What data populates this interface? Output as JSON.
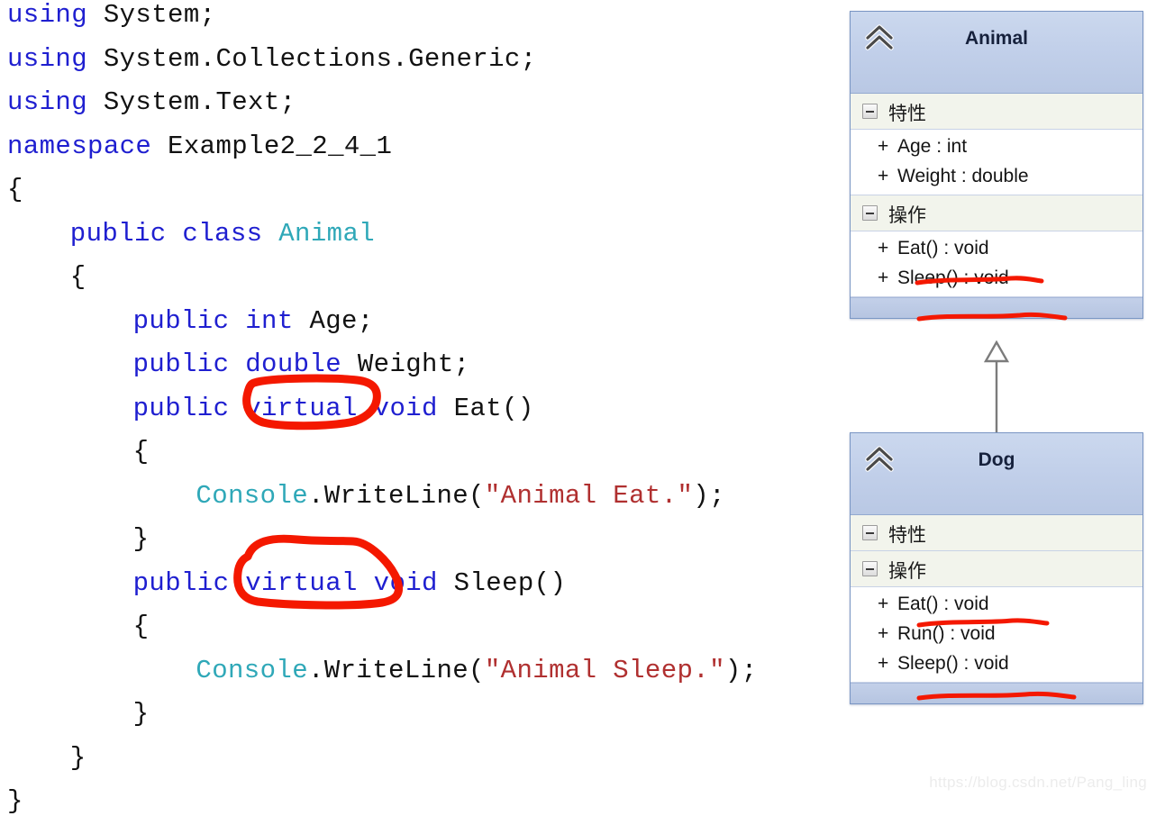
{
  "code": {
    "language": "csharp",
    "lines": [
      {
        "indent": 0,
        "tokens": [
          {
            "t": "using",
            "c": "kw"
          },
          {
            "t": " System;",
            "c": "plain"
          }
        ]
      },
      {
        "indent": 0,
        "tokens": [
          {
            "t": "using",
            "c": "kw"
          },
          {
            "t": " System.Collections.Generic;",
            "c": "plain"
          }
        ]
      },
      {
        "indent": 0,
        "tokens": [
          {
            "t": "using",
            "c": "kw"
          },
          {
            "t": " System.Text;",
            "c": "plain"
          }
        ]
      },
      {
        "indent": 0,
        "tokens": [
          {
            "t": "namespace",
            "c": "kw"
          },
          {
            "t": " Example2_2_4_1",
            "c": "plain"
          }
        ]
      },
      {
        "indent": 0,
        "tokens": [
          {
            "t": "{",
            "c": "plain"
          }
        ]
      },
      {
        "indent": 4,
        "tokens": [
          {
            "t": "public class ",
            "c": "kw"
          },
          {
            "t": "Animal",
            "c": "type-id"
          }
        ]
      },
      {
        "indent": 4,
        "tokens": [
          {
            "t": "{",
            "c": "plain"
          }
        ]
      },
      {
        "indent": 8,
        "tokens": [
          {
            "t": "public int ",
            "c": "kw"
          },
          {
            "t": "Age;",
            "c": "plain"
          }
        ]
      },
      {
        "indent": 8,
        "tokens": [
          {
            "t": "public double ",
            "c": "kw"
          },
          {
            "t": "Weight;",
            "c": "plain"
          }
        ]
      },
      {
        "indent": 8,
        "tokens": [
          {
            "t": "public virtual void ",
            "c": "kw"
          },
          {
            "t": "Eat()",
            "c": "plain"
          }
        ]
      },
      {
        "indent": 8,
        "tokens": [
          {
            "t": "{",
            "c": "plain"
          }
        ]
      },
      {
        "indent": 12,
        "tokens": [
          {
            "t": "Console",
            "c": "type-id"
          },
          {
            "t": ".WriteLine(",
            "c": "plain"
          },
          {
            "t": "\"Animal Eat.\"",
            "c": "str"
          },
          {
            "t": ");",
            "c": "plain"
          }
        ]
      },
      {
        "indent": 8,
        "tokens": [
          {
            "t": "}",
            "c": "plain"
          }
        ]
      },
      {
        "indent": 8,
        "tokens": [
          {
            "t": "public virtual void ",
            "c": "kw"
          },
          {
            "t": "Sleep()",
            "c": "plain"
          }
        ]
      },
      {
        "indent": 8,
        "tokens": [
          {
            "t": "{",
            "c": "plain"
          }
        ]
      },
      {
        "indent": 12,
        "tokens": [
          {
            "t": "Console",
            "c": "type-id"
          },
          {
            "t": ".WriteLine(",
            "c": "plain"
          },
          {
            "t": "\"Animal Sleep.\"",
            "c": "str"
          },
          {
            "t": ");",
            "c": "plain"
          }
        ]
      },
      {
        "indent": 8,
        "tokens": [
          {
            "t": "}",
            "c": "plain"
          }
        ]
      },
      {
        "indent": 4,
        "tokens": [
          {
            "t": "}",
            "c": "plain"
          }
        ]
      },
      {
        "indent": 0,
        "tokens": [
          {
            "t": "}",
            "c": "plain"
          }
        ]
      }
    ]
  },
  "annotations": {
    "ink_color": "#f41800",
    "marks": [
      {
        "name": "circle-virtual-eat",
        "target": "virtual",
        "line": 9,
        "shape": "hand-drawn-oval"
      },
      {
        "name": "circle-virtual-sleep",
        "target": "virtual",
        "line": 13,
        "shape": "hand-drawn-oval"
      },
      {
        "name": "underline-animal-eat",
        "target": "Eat() : void",
        "shape": "hand-drawn-underline"
      },
      {
        "name": "underline-animal-sleep",
        "target": "Sleep() : void",
        "shape": "hand-drawn-underline"
      },
      {
        "name": "underline-dog-eat",
        "target": "Eat() : void",
        "shape": "hand-drawn-underline"
      },
      {
        "name": "underline-dog-sleep",
        "target": "Sleep() : void",
        "shape": "hand-drawn-underline"
      }
    ]
  },
  "uml": {
    "relationship": {
      "type": "generalization",
      "from": "Dog",
      "to": "Animal",
      "arrow": "hollow-triangle"
    },
    "classes": [
      {
        "id": "animal",
        "name": "Animal",
        "header_icon": "chevron-up-double-icon",
        "sections": [
          {
            "label": "特性",
            "icon": "collapse-minus-icon",
            "members": [
              {
                "visibility": "+",
                "text": "Age : int",
                "underlined": false
              },
              {
                "visibility": "+",
                "text": "Weight : double",
                "underlined": false
              }
            ]
          },
          {
            "label": "操作",
            "icon": "collapse-minus-icon",
            "members": [
              {
                "visibility": "+",
                "text": "Eat() : void",
                "underlined": true
              },
              {
                "visibility": "+",
                "text": "Sleep() : void",
                "underlined": true
              }
            ]
          }
        ]
      },
      {
        "id": "dog",
        "name": "Dog",
        "header_icon": "chevron-up-double-icon",
        "sections": [
          {
            "label": "特性",
            "icon": "collapse-minus-icon",
            "members": []
          },
          {
            "label": "操作",
            "icon": "collapse-minus-icon",
            "members": [
              {
                "visibility": "+",
                "text": "Eat() : void",
                "underlined": true
              },
              {
                "visibility": "+",
                "text": "Run() : void",
                "underlined": false
              },
              {
                "visibility": "+",
                "text": "Sleep() : void",
                "underlined": true
              }
            ]
          }
        ]
      }
    ]
  },
  "watermark": {
    "text": "https://blog.csdn.net/Pang_ling"
  },
  "colors": {
    "keyword": "#1f1fd0",
    "type": "#2fa8b8",
    "string": "#b03030",
    "plain": "#121212",
    "ink": "#f41800",
    "uml_header_top": "#cbd8ee",
    "uml_header_bottom": "#b9c8e4",
    "uml_border": "#7a96c4",
    "uml_section_band": "#f2f4ec"
  }
}
